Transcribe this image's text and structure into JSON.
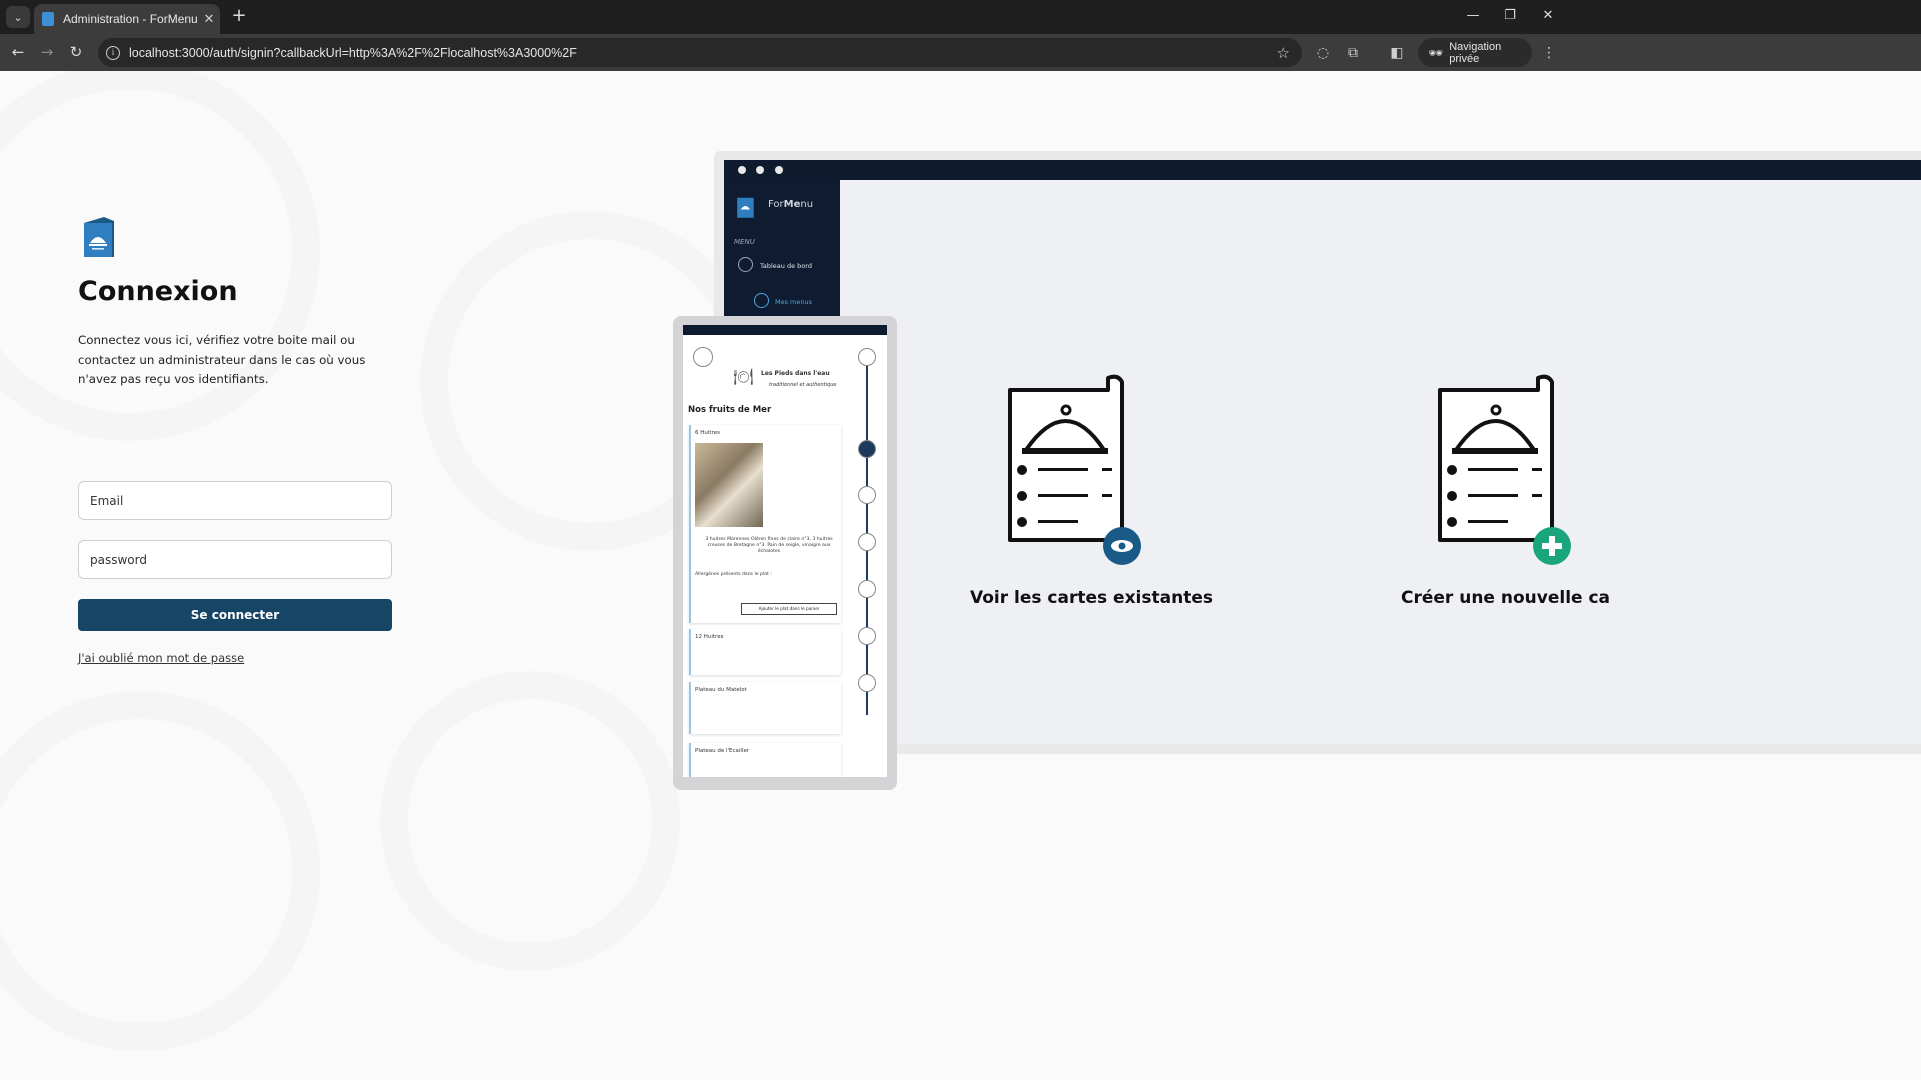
{
  "browser": {
    "tab_title": "Administration - ForMenu",
    "url": "localhost:3000/auth/signin?callbackUrl=http%3A%2F%2Flocalhost%3A3000%2F",
    "private_label": "Navigation privée"
  },
  "login": {
    "heading": "Connexion",
    "subtitle": "Connectez vous ici, vérifiez votre boite mail ou contactez un administrateur dans le cas où vous n'avez pas reçu vos identifiants.",
    "email_placeholder": "Email",
    "password_placeholder": "password",
    "submit_label": "Se connecter",
    "forgot_label": "J'ai oublié mon mot de passe"
  },
  "illustration": {
    "brand_prefix": "For",
    "brand_bold": "Me",
    "brand_suffix": "nu",
    "menu_label": "MENU",
    "nav_dashboard": "Tableau de bord",
    "nav_menus": "Mes menus",
    "card_view": "Voir les cartes existantes",
    "card_create": "Créer une nouvelle ca",
    "restaurant_name": "Les Pieds dans l'eau",
    "restaurant_tagline": "traditionnel et authentique",
    "section_title": "Nos fruits de Mer",
    "dish1": "6 Huitres",
    "dish1_desc": "3 huitres Marennes Oléron fines de claire n°3, 3 huitres creuses de Bretagne n°3. Pain de seigle, vinaigre aux échalotes",
    "allergens": "Allergènes présents dans le plat :",
    "add_to_cart": "Ajouter le plat dans le panier",
    "dish2": "12 Huitres",
    "dish3": "Plateau du Matelot",
    "dish4": "Plateau de l'Ecailler"
  },
  "colors": {
    "primary": "#164565",
    "accent": "#1a5a86",
    "add": "#1ba57d"
  }
}
